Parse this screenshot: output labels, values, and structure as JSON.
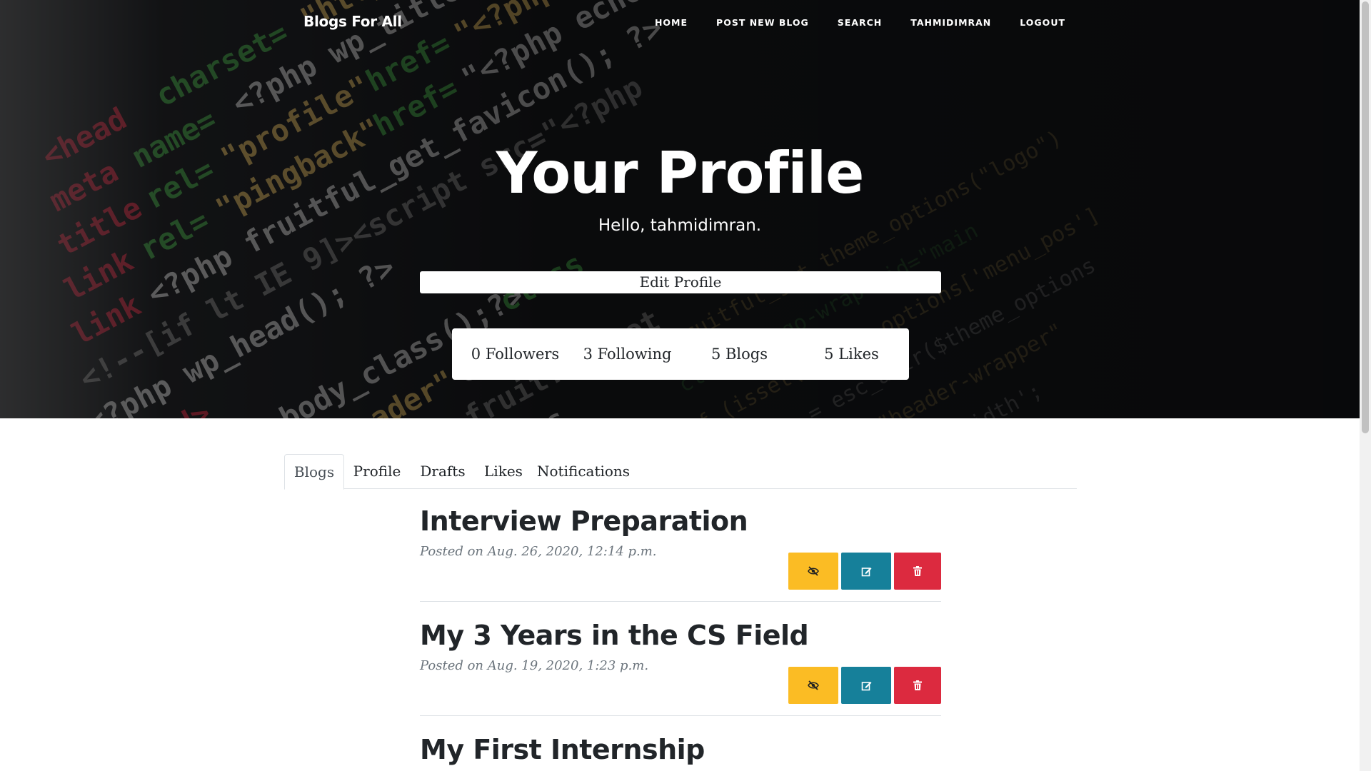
{
  "navbar": {
    "brand": "Blogs For All",
    "links": [
      "HOME",
      "POST NEW BLOG",
      "SEARCH",
      "TAHMIDIMRAN",
      "LOGOUT"
    ]
  },
  "hero": {
    "title": "Your Profile",
    "subtitle": "Hello, tahmidimran.",
    "edit_button": "Edit Profile"
  },
  "stats": [
    "0 Followers",
    "3 Following",
    "5 Blogs",
    "5 Likes"
  ],
  "tabs": [
    "Blogs",
    "Profile",
    "Drafts",
    "Likes",
    "Notifications"
  ],
  "active_tab": "Blogs",
  "posts": [
    {
      "title": "Interview Preparation",
      "meta": "Posted on Aug. 26, 2020, 12:14 p.m."
    },
    {
      "title": "My 3 Years in the CS Field",
      "meta": "Posted on Aug. 19, 2020, 1:23 p.m."
    },
    {
      "title": "My First Internship",
      "meta": ""
    }
  ],
  "post_actions": [
    {
      "name": "hide",
      "icon": "eye-slash-icon",
      "color": "#fbbc24"
    },
    {
      "name": "edit",
      "icon": "edit-icon",
      "color": "#16809a"
    },
    {
      "name": "delete",
      "icon": "trash-icon",
      "color": "#dc2a3f"
    }
  ]
}
